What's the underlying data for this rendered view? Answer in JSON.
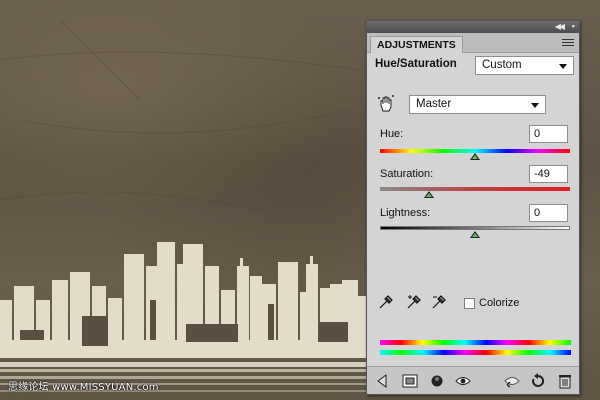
{
  "panel": {
    "tab_label": "ADJUSTMENTS",
    "title": "Hue/Saturation",
    "preset": {
      "value": "Custom"
    },
    "channel": {
      "value": "Master"
    },
    "sliders": [
      {
        "label": "Hue:",
        "value": "0",
        "level": 0.5
      },
      {
        "label": "Saturation:",
        "value": "-49",
        "level": 0.26
      },
      {
        "label": "Lightness:",
        "value": "0",
        "level": 0.5
      }
    ],
    "colorize": {
      "label": "Colorize",
      "checked": false
    },
    "icons": {
      "collapse": "double-chevron-icon",
      "menu": "panel-menu-icon",
      "hand": "targeted-adjustment-hand-icon",
      "eyedroppers": [
        "eyedropper-icon",
        "eyedropper-plus-icon",
        "eyedropper-minus-icon"
      ],
      "bottom": [
        "back-arrow-icon",
        "clip-to-layer-icon",
        "mask-icon",
        "visibility-eye-icon",
        "view-previous-state-icon",
        "reset-icon",
        "trash-icon"
      ]
    }
  },
  "canvas": {
    "watermark": "思缘论坛 www.MISSYUAN.com",
    "colors": {
      "background": "#61574a",
      "skyline": "#e3dccb"
    }
  }
}
